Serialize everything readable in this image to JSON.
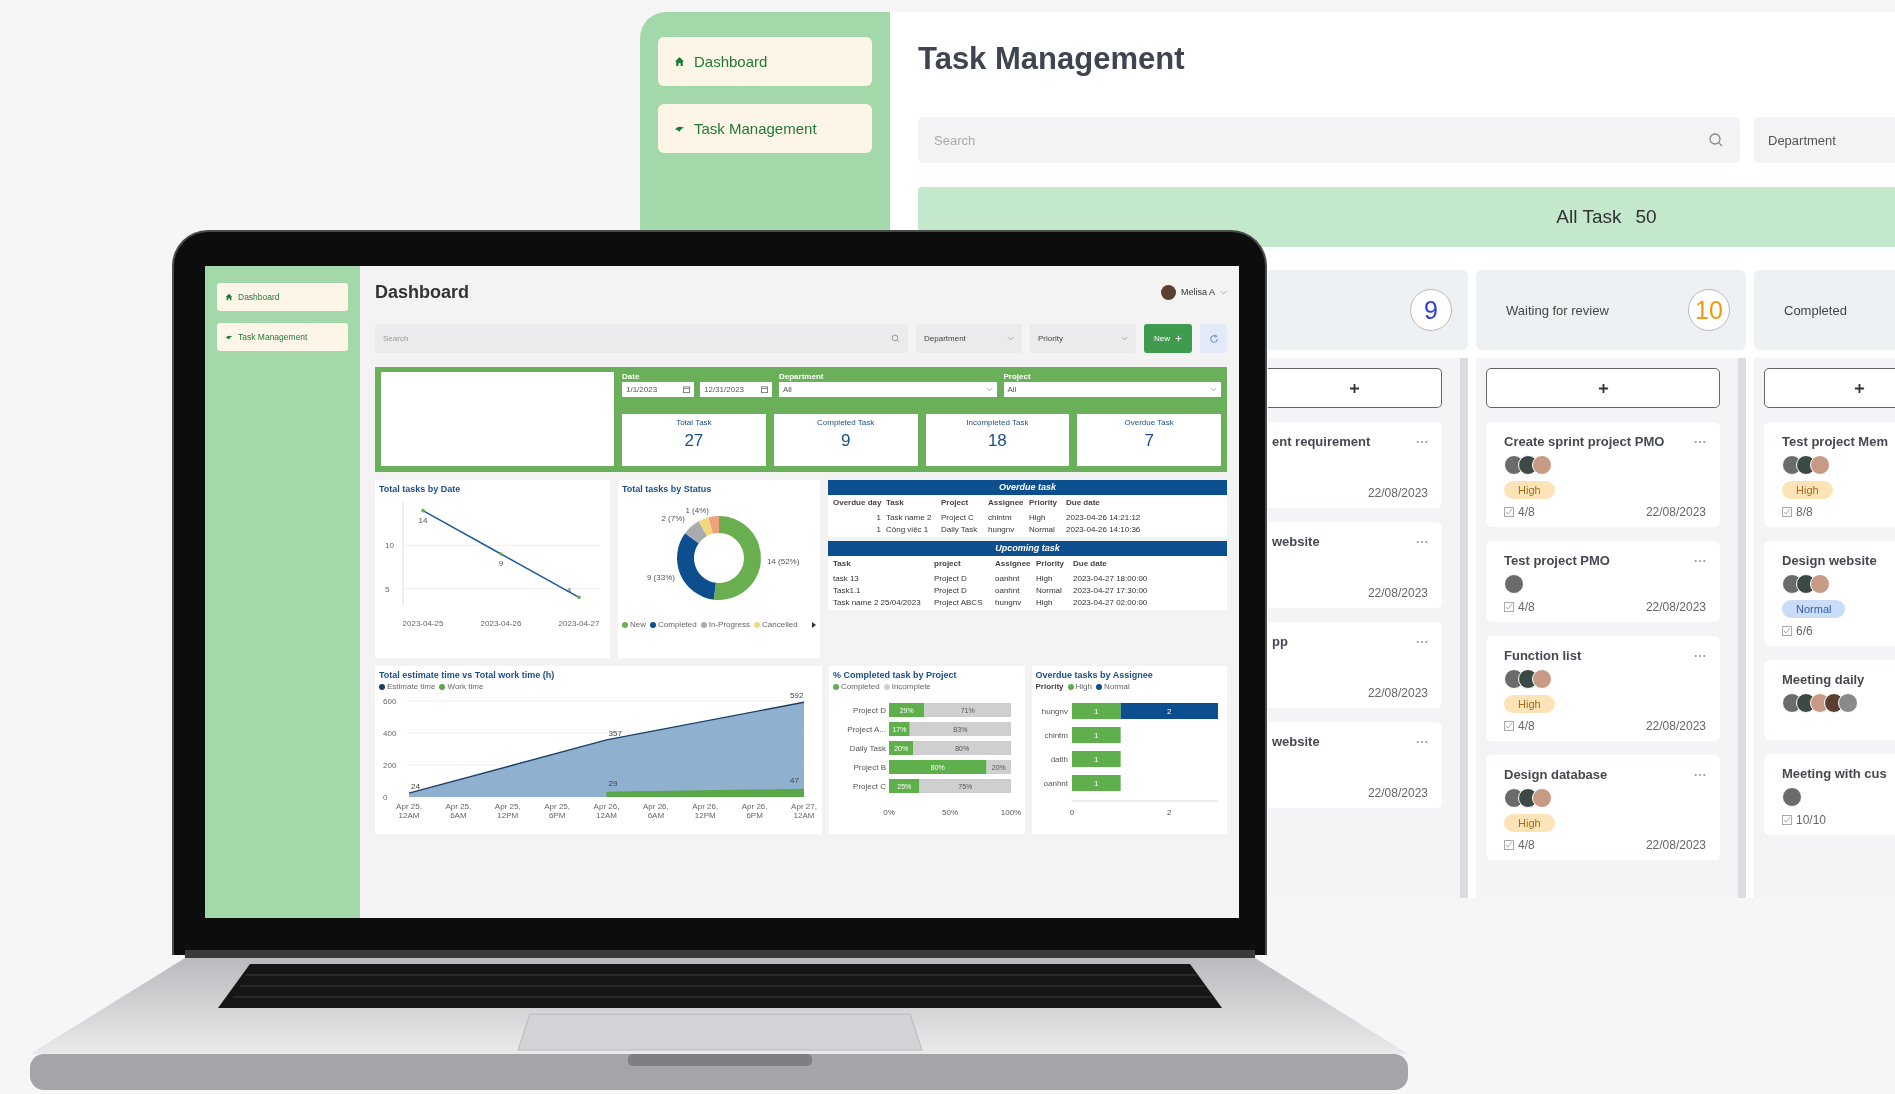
{
  "back_window": {
    "sidebar": {
      "items": [
        {
          "label": "Dashboard"
        },
        {
          "label": "Task Management"
        }
      ]
    },
    "title": "Task Management",
    "search": {
      "placeholder": "Search"
    },
    "department": {
      "placeholder": "Department"
    },
    "banner": {
      "label": "All Task",
      "count": "50"
    },
    "columns": [
      {
        "count": "9",
        "color": "#2a3fd1",
        "cards": [
          {
            "title": "ent requirement",
            "due": "22/08/2023"
          },
          {
            "title": "website",
            "due": "22/08/2023"
          },
          {
            "title": "pp",
            "due": "22/08/2023"
          },
          {
            "title": "website",
            "due": "22/08/2023"
          }
        ]
      },
      {
        "title": "Waiting for review",
        "count": "10",
        "color": "#f29a0e",
        "cards": [
          {
            "title": "Create sprint project PMO",
            "avatars": [
              {
                "kind": "photo"
              },
              {
                "kind": "photo"
              },
              {
                "kind": "photo"
              }
            ],
            "tag": {
              "label": "High",
              "kind": "high"
            },
            "checklist": "4/8",
            "due": "22/08/2023"
          },
          {
            "title": "Test project PMO",
            "avatars": [
              {
                "kind": "photo"
              }
            ],
            "checklist": "4/8",
            "due": "22/08/2023"
          },
          {
            "title": "Function list",
            "avatars": [
              {
                "kind": "photo"
              },
              {
                "kind": "photo"
              },
              {
                "kind": "photo"
              }
            ],
            "tag": {
              "label": "High",
              "kind": "high"
            },
            "checklist": "4/8",
            "due": "22/08/2023"
          },
          {
            "title": "Design database",
            "avatars": [
              {
                "kind": "photo"
              },
              {
                "kind": "photo"
              },
              {
                "kind": "photo"
              }
            ],
            "tag": {
              "label": "High",
              "kind": "high"
            },
            "checklist": "4/8",
            "due": "22/08/2023"
          }
        ]
      },
      {
        "title": "Completed",
        "cards": [
          {
            "title": "Test project Mem",
            "avatars": [
              {
                "kind": "photo"
              },
              {
                "kind": "photo"
              },
              {
                "kind": "photo"
              }
            ],
            "tag": {
              "label": "High",
              "kind": "high"
            },
            "checklist": "8/8"
          },
          {
            "title": "Design website",
            "avatars": [
              {
                "kind": "photo"
              },
              {
                "kind": "photo"
              },
              {
                "kind": "photo"
              }
            ],
            "tag": {
              "label": "Normal",
              "kind": "normal"
            },
            "checklist": "6/6"
          },
          {
            "title": "Meeting daily",
            "avatars": [
              {
                "kind": "photo"
              },
              {
                "kind": "photo"
              },
              {
                "kind": "photo"
              },
              {
                "kind": "photo"
              },
              {
                "kind": "photo"
              }
            ]
          },
          {
            "title": "Meeting with cus",
            "avatars": [
              {
                "kind": "photo"
              }
            ],
            "checklist": "10/10"
          }
        ]
      }
    ]
  },
  "laptop_screen": {
    "sidebar": {
      "items": [
        {
          "label": "Dashboard"
        },
        {
          "label": "Task Management"
        }
      ]
    },
    "title": "Dashboard",
    "user": {
      "name": "Melisa A"
    },
    "search": {
      "placeholder": "Search"
    },
    "filters": [
      {
        "placeholder": "Department"
      },
      {
        "placeholder": "Priority"
      }
    ],
    "new_button": {
      "label": "New"
    },
    "filter_panel": {
      "date": {
        "label": "Date",
        "from": "1/1/2023",
        "to": "12/31/2023"
      },
      "department": {
        "label": "Department",
        "value": "All"
      },
      "project": {
        "label": "Project",
        "value": "All"
      }
    },
    "kpis": [
      {
        "label": "Total Task",
        "value": "27"
      },
      {
        "label": "Completed Task",
        "value": "9"
      },
      {
        "label": "Incompleted Task",
        "value": "18"
      },
      {
        "label": "Overdue Task",
        "value": "7"
      }
    ],
    "tasks_by_date": {
      "chart_data": {
        "type": "line",
        "title": "Total tasks by Date",
        "categories": [
          "2023-04-25",
          "2023-04-26",
          "2023-04-27"
        ],
        "series": [
          {
            "color": "#1f5a9e",
            "values": [
              14,
              9,
              4
            ]
          }
        ],
        "ylim": [
          3,
          15
        ],
        "yticks": [
          5,
          10
        ],
        "data_labels": true
      }
    },
    "tasks_by_status": {
      "chart_data": {
        "type": "donut",
        "title": "Total tasks by Status",
        "categories": [
          "New",
          "Completed",
          "In-Progress",
          "Cancelled",
          null
        ],
        "series": [
          {
            "values": [
              52,
              33,
              7,
              4,
              4
            ]
          }
        ],
        "colors": [
          "#6aaf4f",
          "#0d4f8e",
          "#a9abad",
          "#f1d77e",
          "#f0a07a"
        ],
        "value_labels": [
          "14 (52%)",
          "9 (33%)",
          "2 (7%)",
          "1 (4%)",
          null
        ]
      }
    },
    "overdue_table": {
      "title": "Overdue task",
      "columns": [
        "Overdue day",
        "Task",
        "Project",
        "Assignee",
        "Priority",
        "Due date"
      ],
      "rows": [
        [
          "1",
          "Task name 2",
          "Project C",
          "chintm",
          "High",
          "2023-04-26 14:21:12"
        ],
        [
          "1",
          "Công việc 1",
          "Daily Task",
          "hungnv",
          "Normal",
          "2023-04-26 14:10:36"
        ]
      ]
    },
    "upcoming_table": {
      "title": "Upcoming task",
      "columns": [
        "Task",
        "project",
        "Assignee",
        "Priority",
        "Due date"
      ],
      "rows": [
        [
          "task 13",
          "Project D",
          "oanhnt",
          "High",
          "2023-04-27 18:00:00"
        ],
        [
          "Task1.1",
          "Project D",
          "oanhnt",
          "Normal",
          "2023-04-27 17:30:00"
        ],
        [
          "Task name 2 25/04/2023",
          "Project ABCS",
          "hungnv",
          "High",
          "2023-04-27 02:00:00"
        ]
      ]
    },
    "estimate_vs_work": {
      "chart_data": {
        "type": "area",
        "title": "Total estimate time vs Total work time (h)",
        "categories": [
          "Apr 25, 12AM",
          "Apr 25, 6AM",
          "Apr 25, 12PM",
          "Apr 25, 6PM",
          "Apr 26, 12AM",
          "Apr 26, 6AM",
          "Apr 26, 12PM",
          "Apr 26, 6PM",
          "Apr 27, 12AM"
        ],
        "series": [
          {
            "name": "Estimate time",
            "color": "#1b3f66",
            "values": [
              24,
              null,
              null,
              null,
              357,
              null,
              null,
              null,
              592
            ]
          },
          {
            "name": "Work time",
            "color": "#5aa84a",
            "values": [
              null,
              null,
              null,
              null,
              29,
              null,
              null,
              null,
              47
            ]
          }
        ],
        "ylim": [
          0,
          600
        ],
        "yticks": [
          0,
          200,
          400,
          600
        ],
        "data_labels": true
      }
    },
    "completed_by_project": {
      "chart_data": {
        "type": "bar",
        "orientation": "horizontal",
        "stacked": true,
        "title": "% Completed task by Project",
        "categories": [
          "Project D",
          "Project A...",
          "Daily Task",
          "Project B",
          "Project C"
        ],
        "series": [
          {
            "name": "Completed",
            "color": "#5fb04c",
            "values": [
              29,
              17,
              20,
              80,
              25
            ]
          },
          {
            "name": "Incomplete",
            "color": "#cfcfcf",
            "values": [
              71,
              83,
              80,
              20,
              75
            ]
          }
        ],
        "xlim": [
          0,
          100
        ],
        "xticks": [
          {
            "value": 0,
            "label": "0%"
          },
          {
            "value": 50,
            "label": "50%"
          },
          {
            "value": 100,
            "label": "100%"
          }
        ],
        "value_labels": [
          [
            "29%",
            "17%",
            "20%",
            "80%",
            "25%"
          ],
          [
            "71%",
            "83%",
            "80%",
            "20%",
            "75%"
          ]
        ]
      }
    },
    "overdue_by_assignee": {
      "legend_title": "Priority",
      "chart_data": {
        "type": "bar",
        "orientation": "horizontal",
        "stacked": true,
        "title": "Overdue tasks by Assignee",
        "categories": [
          "hungnv",
          "chintm",
          "datlh",
          "oanhnt"
        ],
        "series": [
          {
            "name": "High",
            "color": "#5fb04c",
            "values": [
              1,
              1,
              1,
              1
            ]
          },
          {
            "name": "Normal",
            "color": "#0d4f8e",
            "values": [
              2,
              null,
              null,
              null
            ]
          }
        ],
        "xlim": [
          0,
          3
        ],
        "xticks": [
          0,
          2
        ],
        "data_labels": true
      }
    }
  }
}
